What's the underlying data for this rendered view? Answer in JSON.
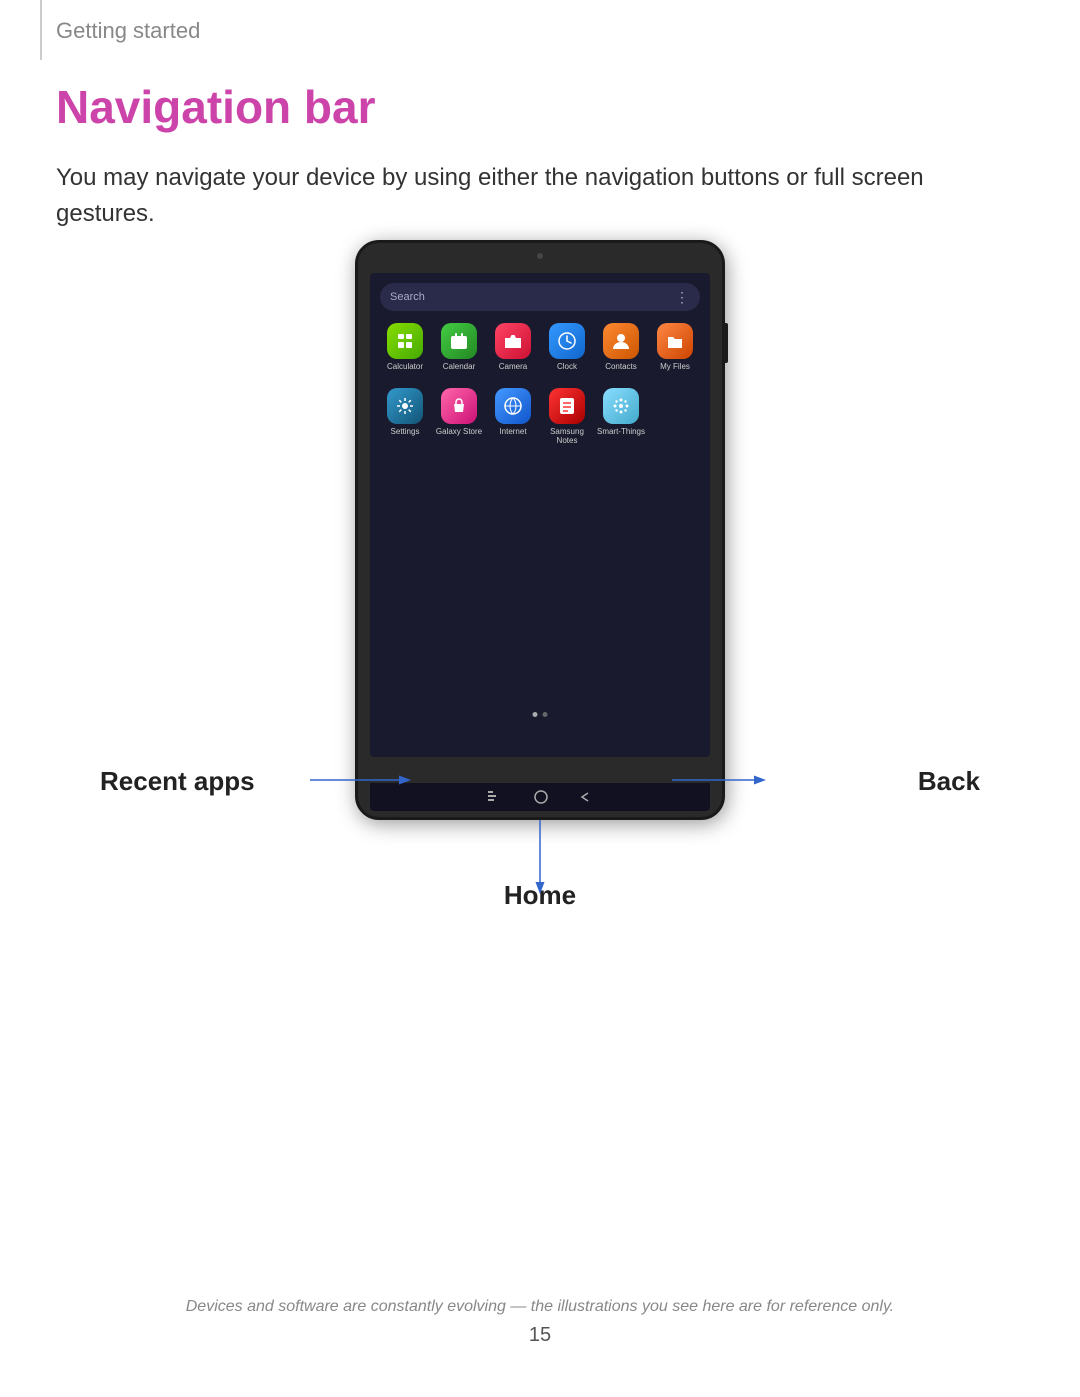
{
  "breadcrumb": "Getting started",
  "page_title": "Navigation bar",
  "page_description": "You may navigate your device by using either the navigation buttons or full screen gestures.",
  "device": {
    "screen": {
      "search_placeholder": "Search",
      "app_rows": [
        [
          {
            "label": "Calculator",
            "icon_class": "icon-calculator",
            "symbol": "🔢"
          },
          {
            "label": "Calendar",
            "icon_class": "icon-calendar",
            "symbol": "📅"
          },
          {
            "label": "Camera",
            "icon_class": "icon-camera",
            "symbol": "📷"
          },
          {
            "label": "Clock",
            "icon_class": "icon-clock",
            "symbol": "🕐"
          },
          {
            "label": "Contacts",
            "icon_class": "icon-contacts",
            "symbol": "👤"
          },
          {
            "label": "My Files",
            "icon_class": "icon-myfiles",
            "symbol": "📁"
          }
        ],
        [
          {
            "label": "Settings",
            "icon_class": "icon-settings",
            "symbol": "⚙"
          },
          {
            "label": "Galaxy Store",
            "icon_class": "icon-galaxystore",
            "symbol": "🛍"
          },
          {
            "label": "Internet",
            "icon_class": "icon-internet",
            "symbol": "🌐"
          },
          {
            "label": "Samsung Notes",
            "icon_class": "icon-samsungnotes",
            "symbol": "📝"
          },
          {
            "label": "Smart-Things",
            "icon_class": "icon-smartthings",
            "symbol": "✳"
          },
          null
        ]
      ]
    }
  },
  "annotations": {
    "recent_apps": "Recent apps",
    "home": "Home",
    "back": "Back"
  },
  "footer": {
    "disclaimer": "Devices and software are constantly evolving — the illustrations you see here are for reference only.",
    "page_number": "15"
  }
}
